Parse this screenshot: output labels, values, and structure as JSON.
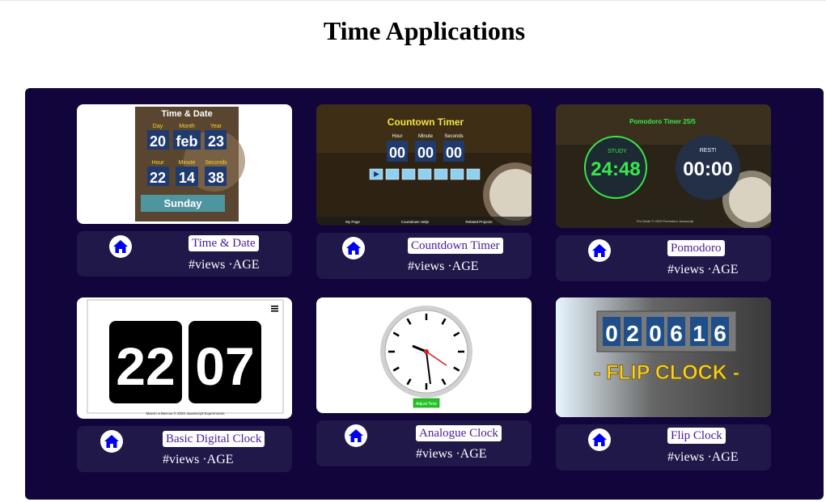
{
  "page": {
    "title": "Time Applications"
  },
  "cards": [
    {
      "title": "Time & Date",
      "meta": "#views ·AGE",
      "thumb": {
        "heading": "Time & Date",
        "labels": [
          "Day",
          "Month",
          "Year",
          "Hour",
          "Minute",
          "Seconds"
        ],
        "values": [
          "20",
          "feb",
          "23",
          "22",
          "14",
          "38"
        ],
        "weekday": "Sunday"
      }
    },
    {
      "title": "Countdown Timer",
      "meta": "#views ·AGE",
      "thumb": {
        "heading": "Countown Timer",
        "labels": [
          "Hour",
          "Minute",
          "Seconds"
        ],
        "values": [
          "00",
          "00",
          "00"
        ],
        "footer": [
          "My Page",
          "Countdown Help!",
          "Related Projects"
        ]
      }
    },
    {
      "title": "Pomodoro",
      "meta": "#views ·AGE",
      "thumb": {
        "heading": "Pomodoro Timer 25/5",
        "study_label": "STUDY",
        "study_value": "24:48",
        "rest_label": "REST!",
        "rest_value": "00:00",
        "footer": "Pro Mode © 2023 Pomodoro Javascript"
      }
    },
    {
      "title": "Basic Digital Clock",
      "meta": "#views ·AGE",
      "thumb": {
        "hours": "22",
        "minutes": "07",
        "footer": "Marvin a Barrow © 2022 JavaScript Experiments"
      }
    },
    {
      "title": "Analogue Clock",
      "meta": "#views ·AGE",
      "thumb": {
        "button": "Adjust Time"
      }
    },
    {
      "title": "Flip Clock",
      "meta": "#views ·AGE",
      "thumb": {
        "digits": [
          "0",
          "2",
          "0",
          "6",
          "1",
          "6"
        ],
        "caption": "- FLIP CLOCK -"
      }
    }
  ],
  "colors": {
    "panel": "#12053b",
    "info": "#21184a",
    "link": "#4a1a9b",
    "home_icon": "#0000ee"
  }
}
